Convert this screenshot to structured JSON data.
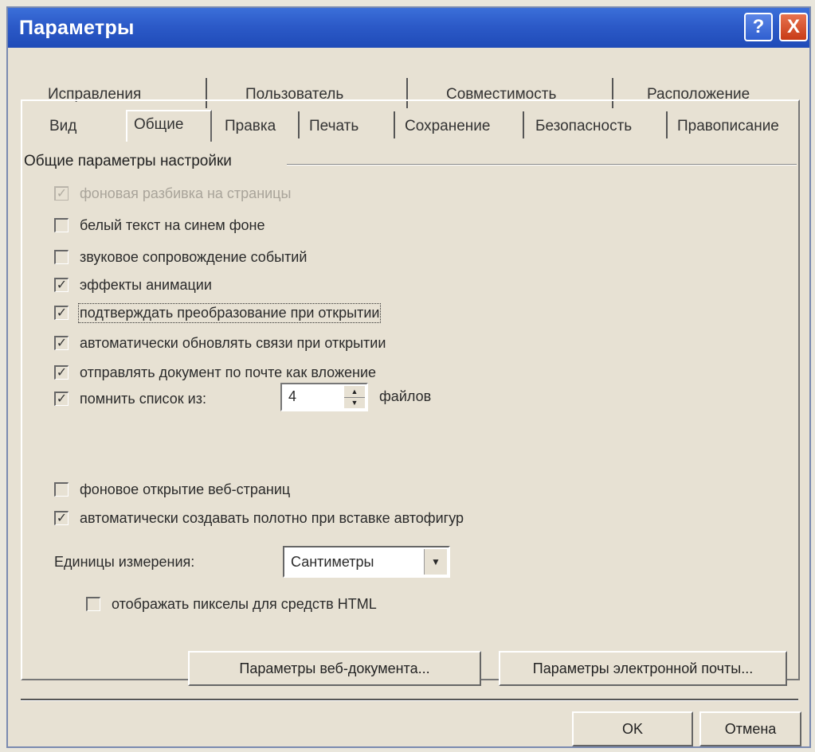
{
  "window": {
    "title": "Параметры"
  },
  "titlebar": {
    "help_glyph": "?",
    "close_glyph": "X"
  },
  "tabs": {
    "back_row": [
      "Исправления",
      "Пользователь",
      "Совместимость",
      "Расположение"
    ],
    "front_row": [
      "Вид",
      "Общие",
      "Правка",
      "Печать",
      "Сохранение",
      "Безопасность",
      "Правописание"
    ],
    "active": "Общие"
  },
  "group": {
    "title": "Общие параметры настройки"
  },
  "options": [
    {
      "label": "фоновая разбивка на страницы",
      "checked": true,
      "disabled": true
    },
    {
      "label": "белый текст на синем фоне",
      "checked": false
    },
    {
      "label": "звуковое сопровождение событий",
      "checked": false
    },
    {
      "label": "эффекты анимации",
      "checked": true
    },
    {
      "label": "подтверждать преобразование при открытии",
      "checked": true
    },
    {
      "label": "автоматически обновлять связи при открытии",
      "checked": true
    },
    {
      "label": "отправлять документ по почте как вложение",
      "checked": true
    },
    {
      "label": "помнить список из:",
      "checked": true
    },
    {
      "label": "фоновое открытие веб-страниц",
      "checked": false
    },
    {
      "label": "автоматически создавать полотно при вставке автофигур",
      "checked": true
    }
  ],
  "recent_files": {
    "value": "4",
    "suffix": "файлов"
  },
  "units": {
    "label": "Единицы измерения:",
    "value": "Сантиметры"
  },
  "pixels_option": {
    "label": "отображать пикселы для средств HTML",
    "checked": false
  },
  "buttons": {
    "web": "Параметры веб-документа...",
    "email": "Параметры электронной почты...",
    "ok": "OK",
    "cancel": "Отмена"
  },
  "check_glyph": "✓"
}
